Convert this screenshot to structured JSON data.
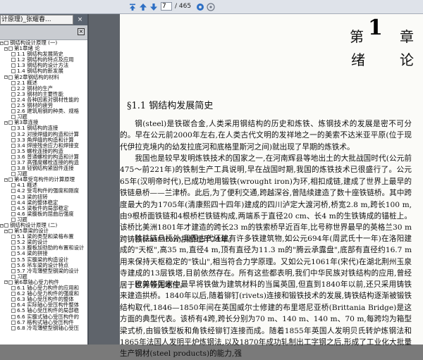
{
  "toolbar": {
    "current_page": "7",
    "total_pages": "/ 465"
  },
  "document_tab": {
    "title": "计原理)_张耀春..."
  },
  "outline": {
    "items": [
      {
        "level": 0,
        "toggle": "-",
        "text": "钢结构设计原理 (一)"
      },
      {
        "level": 1,
        "toggle": "-",
        "text": "第1章绪    论"
      },
      {
        "level": 2,
        "text": "1.1   钢结构发展简史"
      },
      {
        "level": 2,
        "text": "1.2   钢结构的特点及应用"
      },
      {
        "level": 2,
        "text": "1.3   钢结构的设计方法"
      },
      {
        "level": 2,
        "text": "1.4   钢结构的新发展"
      },
      {
        "level": 1,
        "toggle": "-",
        "text": "第2章钢结构的材料"
      },
      {
        "level": 2,
        "text": "2.1   概述"
      },
      {
        "level": 2,
        "text": "2.2   钢材的生产"
      },
      {
        "level": 2,
        "text": "2.3   钢材的主要性能"
      },
      {
        "level": 2,
        "text": "2.4   各种因素对钢材性能的"
      },
      {
        "level": 2,
        "text": "2.5   钢材的疲劳"
      },
      {
        "level": 2,
        "text": "2.6   建筑用钢的种类、规格"
      },
      {
        "level": 2,
        "text": "习题"
      },
      {
        "level": 1,
        "toggle": "-",
        "text": "第3章连接"
      },
      {
        "level": 2,
        "text": "3.1   钢结构的连接"
      },
      {
        "level": 2,
        "text": "3.2   对接焊缝的构造和计算"
      },
      {
        "level": 2,
        "text": "3.3   角焊缝的构造和计算"
      },
      {
        "level": 2,
        "text": "3.4   焊接残余应力和焊接变"
      },
      {
        "level": 2,
        "text": "3.5   螺栓连接的构造"
      },
      {
        "level": 2,
        "text": "3.6   普通螺栓的构造和计算"
      },
      {
        "level": 2,
        "text": "3.7   高强度螺栓连接的构造"
      },
      {
        "level": 2,
        "text": "3.8   轻钢结构紧固件连接"
      },
      {
        "level": 2,
        "text": "习题"
      },
      {
        "level": 1,
        "toggle": "-",
        "text": "第4章受弯构件的计算原理"
      },
      {
        "level": 2,
        "text": "4.1   概述"
      },
      {
        "level": 2,
        "text": "4.2   受弯构件的强度和刚度"
      },
      {
        "level": 2,
        "text": "4.3   梁的扭转"
      },
      {
        "level": 2,
        "text": "4.4   梁的整体稳定"
      },
      {
        "level": 2,
        "text": "4.5   梁板件的局部稳定"
      },
      {
        "level": 2,
        "text": "4.6   梁腹板的屈曲后强度"
      },
      {
        "level": 2,
        "text": "习题"
      },
      {
        "level": 0,
        "toggle": "-",
        "text": "钢结构设计原理 (二)"
      },
      {
        "level": 1,
        "toggle": "-",
        "text": "第5章梁的设计"
      },
      {
        "level": 2,
        "text": "5.1   梁的类型和梁格布置"
      },
      {
        "level": 2,
        "text": "5.2   梁的设计"
      },
      {
        "level": 2,
        "text": "5.3   腹板加劲肋的布置和设计"
      },
      {
        "level": 2,
        "text": "5.4   梁的拼接"
      },
      {
        "level": 2,
        "text": "5.5   实腹梁的构造设计"
      },
      {
        "level": 2,
        "text": "5.6   吊车梁的设计特点"
      },
      {
        "level": 2,
        "text": "5.7   冷弯薄壁型钢梁的设计"
      },
      {
        "level": 2,
        "text": "习题"
      },
      {
        "level": 1,
        "toggle": "-",
        "text": "第6章轴心受力构件"
      },
      {
        "level": 2,
        "text": "6.1   轴心受力构件的应用和"
      },
      {
        "level": 2,
        "text": "6.2   轴心受力构件的强度和"
      },
      {
        "level": 2,
        "text": "6.3   轴心受压构件的整体"
      },
      {
        "level": 2,
        "text": "6.4   实际轴心受压构件整体"
      },
      {
        "level": 2,
        "text": "6.5   轴心受压构件的局部稳"
      },
      {
        "level": 2,
        "text": "6.6   实腹式轴心受压构件的"
      },
      {
        "level": 2,
        "text": "6.7   格构式轴心受压构件"
      },
      {
        "level": 2,
        "text": "6.8   冷弯薄壁型钢轴心受压"
      }
    ]
  },
  "page": {
    "chapter_word_left": "第",
    "chapter_number": "1",
    "chapter_word_right": "章",
    "chapter_title_left": "绪",
    "chapter_title_right": "论",
    "section_title": "§1.1   钢结构发展简史",
    "paragraphs": [
      "钢(steel)是铁碳合金,人类采用钢结构的历史和炼铁、炼钢技术的发展是密不可分的。早在公元前2000年左右,在人类古代文明的发祥地之一的美索不达米亚平原(位于现代伊拉克境内的幼发拉底河和底格里斯河之间)就出现了早期的炼铁术。",
      "我国也是较早发明炼铁技术的国家之一,在河南辉县等地出土的大批战国时代(公元前475～前221年)的铁制生产工具说明,早在战国时期,我国的炼铁技术已很盛行了。公元65年(汉明帝时代),已成功地用锻铁(wrought iron)为环,相扣成链,建成了世界上最早的铁链悬桥——兰津桥。此后,为了便利交通,跨越深谷,曾陆续建造了数十座铁链桥。其中跨度最大的为1705年(清康熙四十四年)建成的四川泸定大渡河桥,桥宽2.8 m,跨长100 m,由9根桥面铁链和4根桥栏铁链构成,两端系于直径20 cm、长4 m的生铁铸成的锚桩上。该桥比美洲1801年才建造的跨长23 m的铁索桥早近百年,比号称世界最早的英格兰30 m跨铸铁(cast iron)拱桥也早74年。",
      "除铁链悬桥外,我国古代还建有许多铁建筑物,如公元694年(周武氏十一年)在洛阳建成的\"天枢\",高35 m,直径4 m,顶有直径为11.3 m的\"腾云承露盘\",底部有直径约16.7 m用来保持天枢稳定的\"铁山\",相当符合力学原理。又如公元1061年(宋代)在湖北荆州玉泉寺建成的13层铁塔,目前依然存在。所有这些都表明,我们中华民族对铁结构的应用,曾经居于世界领先地位。",
      "欧美等国家中最早将铁做为建筑材料的当属英国,但直到1840年以前,还只采用铸铁来建造拱桥。1840年以后,随着铆钉(rivets)连接和锻铁技术的发展,铸铁结构逐渐被锻铁结构取代,1846—1850年间在英国威尔士修建的布里塔尼亚桥(Brittania Bridge)是这方面的典型代表。该桥有4跨,跨长分别为70 m、140 m、140 m、70 m,每跨均为箱型梁式桥,由锻铁型板和角铁经铆钉连接而成。随着1855年英国人发明贝氏转炉炼钢法和1865年法国人发明平炉炼钢法,以及1870年成功轧制出工字钢之后,形成了工业化大批量生产钢材(steel products)的能力,强"
    ]
  }
}
